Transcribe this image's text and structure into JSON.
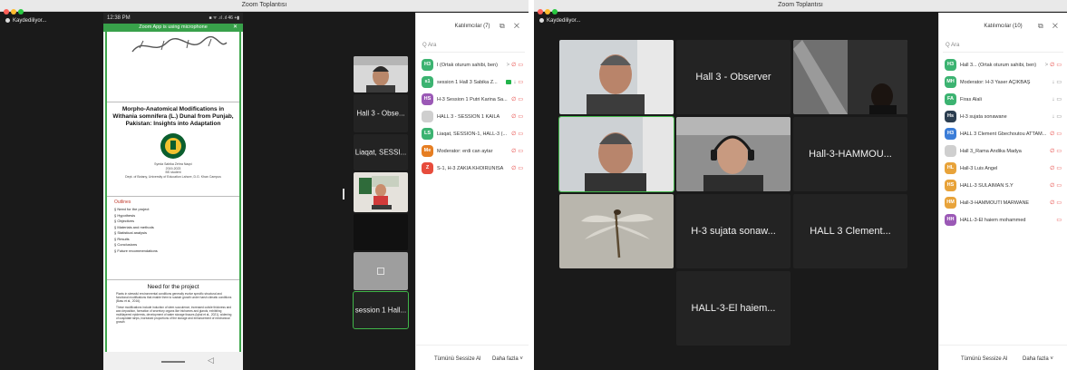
{
  "colors": {
    "accent_green": "#41b649",
    "mic_off_red": "#e53935",
    "tile_bg": "#232323",
    "stage_bg": "#1a1a1a"
  },
  "windows": [
    {
      "title": "Zoom Toplantısı",
      "recording": "Kaydediliyor...",
      "phone": {
        "time": "12:38 PM",
        "signal": "■ ᯤ .ıl .ıl 46 +▮",
        "mic_banner": "Zoom App is using microphone",
        "slide_title": "Morpho-Anatomical Modifications in Withania somnifera (L.) Dunal from Punjab, Pakistan: Insights into Adaptation",
        "student_name": "Syeda Sabika Zehra Naqvi",
        "student_year": "2019-2023",
        "student_role": "BS student",
        "department": "Dept. of Botany, University of Education Lahore, D.G. Khan Campus",
        "outline_title": "Outlines",
        "outline_items": [
          "Need for the project",
          "Hypothesis",
          "Objectives",
          "Materials and methods",
          "Statistical analysis",
          "Results",
          "Conclusions",
          "Future recommendations"
        ],
        "need_title": "Need for the project",
        "need_para1": "Plants in stressful environmental conditions generally evolve specific structural and functional modifications that enable them to sustain growth under harsh climatic conditions (Basu et al., 2016).",
        "need_para2": "These modifications include induction of stem succulence, increased cuticle thickness and wax deposition, formation of secretory organs like trichomes and glands, exhibiting multilayered epidermis, development of water storage tissues (Iqbal et al., 2021), widening of cuspidate strips, increased proportions of the storage and enhancement of mechanical growth"
      },
      "tiles": [
        {
          "label": ""
        },
        {
          "label": "Hall 3 - Obse..."
        },
        {
          "label": "Liaqat, SESSI..."
        },
        {
          "label": ""
        },
        {
          "label": ""
        },
        {
          "label": ""
        },
        {
          "label": "session 1 Hall..."
        }
      ],
      "panel": {
        "title": "Katılımcılar (7)",
        "controls": "⧉ ✕",
        "search_placeholder": "Q Ara",
        "participants": [
          {
            "initials": "H3",
            "name": "I (Ortak oturum sahibi, ben)",
            "color": "#3cb371",
            "mic": "off",
            "cam": "off",
            "extra": ">"
          },
          {
            "initials": "s1",
            "name": "session 1 Hall 3 Sabika Z...",
            "color": "#3cb371",
            "mic": "on",
            "cam": "off",
            "share": true
          },
          {
            "initials": "HS",
            "name": "H-3 Session 1 Putri Karina Sa...",
            "color": "#9b59b6",
            "mic": "off",
            "cam": "off"
          },
          {
            "initials": "",
            "name": "HALL 3 - SESSION 1 KAILA",
            "color": "#cfcfcf",
            "mic": "off",
            "cam": "off"
          },
          {
            "initials": "LS",
            "name": "Liaqat, SESSION-1, HALL-3 (...",
            "color": "#3cb371",
            "mic": "off",
            "cam": "off"
          },
          {
            "initials": "Me",
            "name": "Moderator: erdi can aytar",
            "color": "#e67e22",
            "mic": "off",
            "cam": "off"
          },
          {
            "initials": "Z",
            "name": "S-1, H-3 ZAKIA KHOIRUNISA",
            "color": "#e74c3c",
            "mic": "off",
            "cam": "off"
          }
        ],
        "footer_left": "Tümünü Sessize Al",
        "footer_right": "Daha fazla ˅"
      }
    },
    {
      "title": "Zoom Toplantısı",
      "recording": "Kaydediliyor...",
      "tiles": [
        {
          "label": ""
        },
        {
          "label": "Hall 3 - Observer"
        },
        {
          "label": ""
        },
        {
          "label": ""
        },
        {
          "label": ""
        },
        {
          "label": "Hall-3-HAMMOU..."
        },
        {
          "label": ""
        },
        {
          "label": "H-3 sujata sonaw..."
        },
        {
          "label": "HALL 3 Clement..."
        },
        {
          "label": "HALL-3-El haiem..."
        }
      ],
      "panel": {
        "title": "Katılımcılar (10)",
        "controls": "⧉ ✕",
        "search_placeholder": "Q Ara",
        "participants": [
          {
            "initials": "H3",
            "name": "Hall 3... (Ortak oturum sahibi, ben)",
            "color": "#3cb371",
            "mic": "off",
            "cam": "off",
            "extra": ">"
          },
          {
            "initials": "MH",
            "name": "Moderator: H-3 Yaser AÇIKBAŞ",
            "color": "#3cb371",
            "mic": "on",
            "cam": "on"
          },
          {
            "initials": "FA",
            "name": "Firas Alali",
            "color": "#3cb371",
            "mic": "on",
            "cam": "on"
          },
          {
            "initials": "Hs",
            "name": "H-3 sujata sonawane",
            "color": "#2c3e50",
            "mic": "on",
            "cam": "on"
          },
          {
            "initials": "H3",
            "name": "HALL 3 Clement Gbechoutou ATTAM...",
            "color": "#3b7dd8",
            "mic": "off",
            "cam": "off"
          },
          {
            "initials": "",
            "name": "Hall 3_Rama Andika Madya",
            "color": "#cfcfcf",
            "mic": "off",
            "cam": "off"
          },
          {
            "initials": "HL",
            "name": "Hall-3 Luis Angel",
            "color": "#e8a33a",
            "mic": "off",
            "cam": "off"
          },
          {
            "initials": "HS",
            "name": "HALL-3 SULAIMAN S.Y",
            "color": "#e8a33a",
            "mic": "off",
            "cam": "off"
          },
          {
            "initials": "HM",
            "name": "Hall-3-HAMMOUTI MARWANE",
            "color": "#e8a33a",
            "mic": "off",
            "cam": "off"
          },
          {
            "initials": "HH",
            "name": "HALL-3-El haiem mohammed",
            "color": "#9b59b6",
            "mic": "none",
            "cam": "off"
          }
        ],
        "footer_left": "Tümünü Sessize Al",
        "footer_right": "Daha fazla ˅"
      }
    }
  ]
}
